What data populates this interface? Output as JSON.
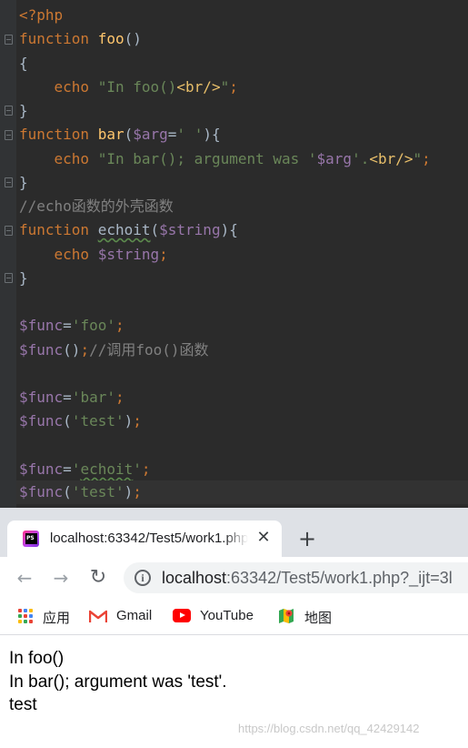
{
  "editor": {
    "lines": {
      "l1": {
        "tag": "<?php"
      },
      "l2": {
        "kw": "function",
        "name": "foo",
        "paren": "()"
      },
      "l3": {
        "brace": "{"
      },
      "l4": {
        "echo": "echo",
        "q1": "\"",
        "text": "In foo()",
        "html": "<br/>",
        "q2": "\"",
        "semi": ";"
      },
      "l5": {
        "brace": "}"
      },
      "l6": {
        "kw": "function",
        "name": "bar",
        "open": "(",
        "arg": "$arg",
        "eq": "=",
        "str": "' '",
        "close": "){"
      },
      "l7": {
        "echo": "echo",
        "q1": "\"",
        "text": "In bar(); argument was '",
        "var": "$arg",
        "text2": "'.",
        "html": "<br/>",
        "q2": "\"",
        "semi": ";"
      },
      "l8": {
        "brace": "}"
      },
      "l9": {
        "comment": "//echo函数的外壳函数"
      },
      "l10": {
        "kw": "function",
        "name": "echoit",
        "open": "(",
        "var": "$string",
        "close": "){"
      },
      "l11": {
        "echo": "echo",
        "var": "$string",
        "semi": ";"
      },
      "l12": {
        "brace": "}"
      },
      "l14": {
        "var": "$func",
        "eq": "=",
        "str": "'foo'",
        "semi": ";"
      },
      "l15": {
        "var": "$func",
        "paren": "()",
        "semi": ";",
        "comment": "//调用foo()函数"
      },
      "l17": {
        "var": "$func",
        "eq": "=",
        "str": "'bar'",
        "semi": ";"
      },
      "l18": {
        "var": "$func",
        "open": "(",
        "str": "'test'",
        "close": ")",
        "semi": ";"
      },
      "l20": {
        "var": "$func",
        "eq": "=",
        "q1": "'",
        "str": "echoit",
        "q2": "'",
        "semi": ";"
      },
      "l21": {
        "var": "$func",
        "open": "(",
        "str": "'test'",
        "close": ")",
        "semi": ";"
      }
    }
  },
  "browser": {
    "tab": {
      "title": "localhost:63342/Test5/work1.php",
      "close": "✕",
      "favicon": "phpstorm-icon"
    },
    "new_tab": "+",
    "nav": {
      "back": "←",
      "forward": "→",
      "reload": "↻"
    },
    "omnibox": {
      "info": "i",
      "url_host": "localhost",
      "url_rest": ":63342/Test5/work1.php?_ijt=3l"
    },
    "bookmarks": [
      {
        "label": "应用",
        "icon": "apps-grid-icon"
      },
      {
        "label": "Gmail",
        "icon": "gmail-icon"
      },
      {
        "label": "YouTube",
        "icon": "youtube-icon"
      },
      {
        "label": "地图",
        "icon": "maps-icon"
      }
    ],
    "output": [
      "In foo()",
      "In bar(); argument was 'test'.",
      "test"
    ],
    "watermark": "https://blog.csdn.net/qq_42429142"
  },
  "colors": {
    "editor_bg": "#2b2b2b",
    "keyword": "#cc7832",
    "function_name": "#ffc66d",
    "variable": "#9876aa",
    "string": "#6a8759",
    "comment": "#808080",
    "html_tag": "#e8bf6a",
    "tabstrip_bg": "#dee1e6"
  }
}
